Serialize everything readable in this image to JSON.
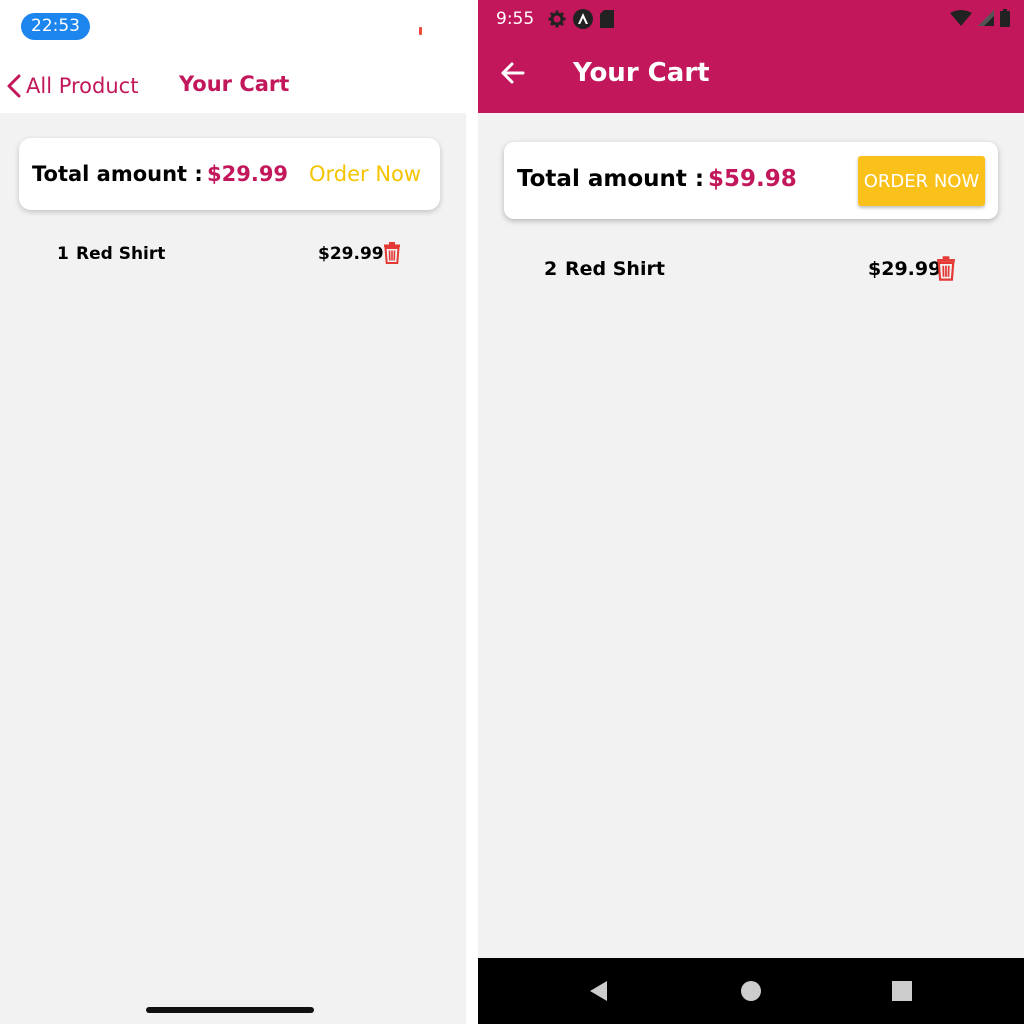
{
  "ios": {
    "status_time": "22:53",
    "nav": {
      "back_label": "All Product",
      "title": "Your Cart"
    },
    "summary": {
      "total_label": "Total amount :",
      "total_amount": "$29.99",
      "order_label": "Order Now"
    },
    "items": [
      {
        "qty": "1",
        "name": "Red Shirt",
        "price": "$29.99"
      }
    ]
  },
  "android": {
    "status_time": "9:55",
    "title": "Your Cart",
    "summary": {
      "total_label": "Total amount :",
      "total_amount": "$59.98",
      "order_label": "ORDER NOW"
    },
    "items": [
      {
        "qty": "2",
        "name": "Red Shirt",
        "price": "$29.99"
      }
    ]
  },
  "colors": {
    "brand": "#c2185b",
    "order_text_ios": "#f5c400",
    "order_button_android": "#fbc11b",
    "trash": "#e53935",
    "background": "#f2f2f2"
  },
  "icons": {
    "ios_back": "chevron-left-icon",
    "android_back": "arrow-left-icon",
    "delete": "trash-icon",
    "android_nav": [
      "triangle-back-icon",
      "circle-home-icon",
      "square-recents-icon"
    ]
  }
}
